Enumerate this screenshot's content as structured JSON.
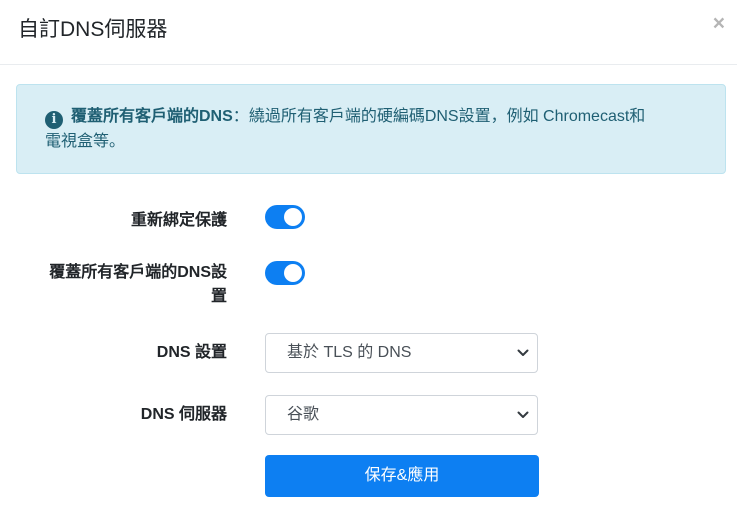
{
  "dialog": {
    "title": "自訂DNS伺服器",
    "close_label": "×"
  },
  "alert": {
    "icon": "info-circle-icon",
    "bold_text": "覆蓋所有客戶端的DNS",
    "separator": "：",
    "text_line1": "繞過所有客戶端的硬編碼DNS設置，例如 Chromecast和",
    "text_line2": "電視盒等。"
  },
  "form": {
    "rebind_protection": {
      "label": "重新綁定保護",
      "enabled": true
    },
    "override_dns": {
      "label_line1": "覆蓋所有客戶端的DNS設",
      "label_line2": "置",
      "enabled": true
    },
    "dns_setting": {
      "label": "DNS 設置",
      "value": "基於 TLS 的 DNS"
    },
    "dns_server": {
      "label": "DNS 伺服器",
      "value": "谷歌"
    },
    "save_button": "保存&應用"
  },
  "colors": {
    "accent": "#0d7ff2",
    "alert_bg": "#d9eef5",
    "alert_text": "#1f5f73"
  }
}
